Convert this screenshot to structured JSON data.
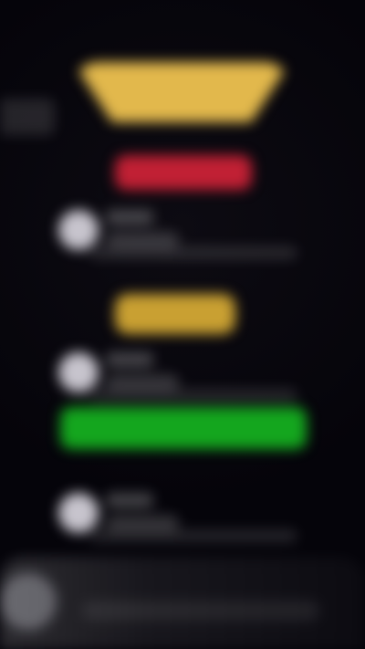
{
  "app": {
    "screen_state": "blurred"
  },
  "colors": {
    "background": "#05040a",
    "gold": "#e2b84c",
    "red": "#c12034",
    "gold_secondary": "#c9a032",
    "green": "#14a61e",
    "neutral": "#c7c4cd"
  },
  "icons": {
    "avatar": "avatar-icon"
  }
}
